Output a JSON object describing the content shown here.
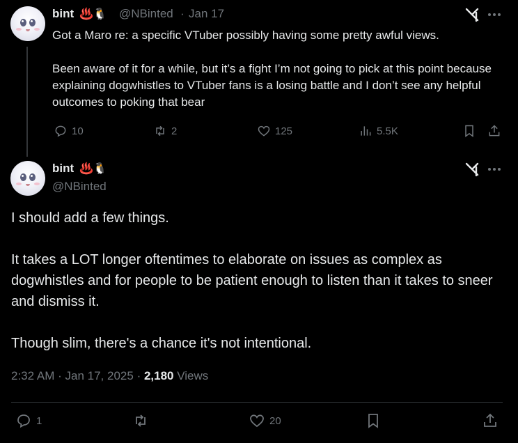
{
  "parent_tweet": {
    "display_name": "bint",
    "name_emojis": "♨️🐧",
    "handle": "@NBinted",
    "separator": "·",
    "date": "Jan 17",
    "paragraphs": [
      "Got a Maro re: a specific VTuber possibly having some pretty awful views.",
      "Been aware of it for a while, but it’s a fight I’m not going to pick at this point because explaining dogwhistles to VTuber fans is a losing battle and I don’t see any helpful outcomes to poking that bear"
    ],
    "replies": "10",
    "reposts": "2",
    "likes": "125",
    "views": "5.5K"
  },
  "main_tweet": {
    "display_name": "bint",
    "name_emojis": "♨️🐧",
    "handle": "@NBinted",
    "paragraphs": [
      "I should add a few things.",
      "It takes a LOT longer oftentimes to elaborate on issues as complex as dogwhistles and for people to be patient enough to listen than it takes to sneer and dismiss it.",
      "Though slim, there's a chance it's not intentional."
    ],
    "time": "2:32 AM",
    "date": "Jan 17, 2025",
    "separator": "·",
    "views_count": "2,180",
    "views_label": "Views",
    "replies": "1",
    "likes": "20"
  },
  "icons": {
    "grok": "grok-icon",
    "more": "more-icon",
    "reply": "reply-icon",
    "repost": "repost-icon",
    "like": "heart-icon",
    "views": "analytics-icon",
    "bookmark": "bookmark-icon",
    "share": "share-icon"
  },
  "colors": {
    "background": "#000000",
    "text": "#e7e9ea",
    "muted": "#71767b",
    "divider": "#2f3336"
  }
}
